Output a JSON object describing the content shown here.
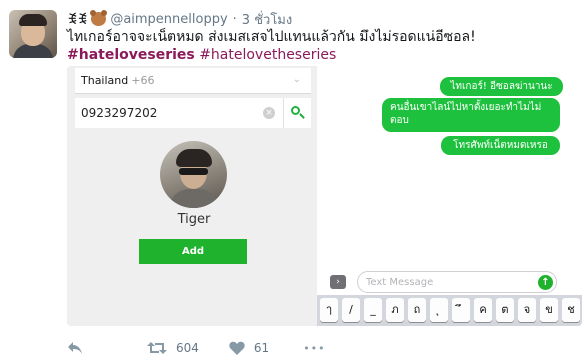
{
  "tweet": {
    "display_name": "ꉂꉂ",
    "handle": "@aimpennelloppy",
    "separator": "·",
    "time": "3 ชั่วโมง",
    "text": "ไทเกอร์อาจจะเน็ตหมด ส่งเมสเสจไปแทนแล้วกัน มึงไม่รอดแน่อีซอล!",
    "hashtags": [
      "#hateloveseries",
      "#hatelovetheseries"
    ]
  },
  "screenshot": {
    "country": "Thailand",
    "country_code": "+66",
    "phone_number": "0923297202",
    "clear_glyph": "×",
    "profile_name": "Tiger",
    "add_button_label": "Add",
    "messages": [
      "ไทเกอร์! อีซอลฆ่านานะ",
      "คนอื่นเขาไลน์ไปหาตั้งเยอะทำไมไม่ตอบ",
      "โทรศัพท์เน็ตหมดเหรอ"
    ],
    "message_placeholder": "Text Message",
    "expand_glyph": "›",
    "send_glyph": "↑",
    "keyboard_keys": [
      "ๅ",
      "/",
      "_",
      "ภ",
      "ถ",
      "ุ",
      "ึ",
      "ค",
      "ต",
      "จ",
      "ข",
      "ช"
    ]
  },
  "actions": {
    "retweet_count": "604",
    "like_count": "61",
    "more_glyph": "•••"
  },
  "colors": {
    "accent_green": "#1fb32d",
    "bubble_green": "#1ec13e",
    "hashtag": "#8b1a5a",
    "muted": "#657786"
  },
  "icons": [
    "reply-icon",
    "retweet-icon",
    "like-icon",
    "more-icon",
    "search-icon",
    "clear-icon",
    "send-icon",
    "bear-emoji-icon"
  ]
}
